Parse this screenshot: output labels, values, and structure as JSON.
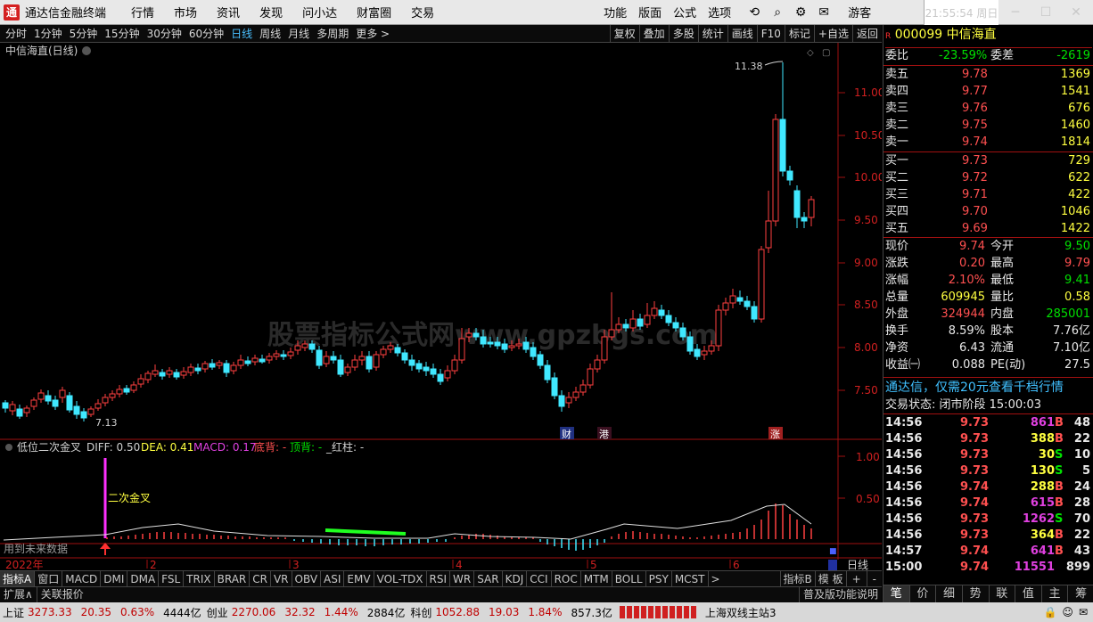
{
  "app": {
    "title": "通达信金融终端",
    "logo": "通",
    "menus": [
      "行情",
      "市场",
      "资讯",
      "发现",
      "问小达",
      "财富圈",
      "交易"
    ],
    "right_menus": [
      "功能",
      "版面",
      "公式",
      "选项"
    ],
    "user": "游客",
    "clock": "21:55:54 周日"
  },
  "periods": [
    "分时",
    "1分钟",
    "5分钟",
    "15分钟",
    "30分钟",
    "60分钟",
    "日线",
    "周线",
    "月线",
    "多周期",
    "更多 >"
  ],
  "period_active": 6,
  "tools": [
    "复权",
    "叠加",
    "多股",
    "统计",
    "画线",
    "F10",
    "标记",
    "+自选",
    "返回"
  ],
  "chart": {
    "title": "中信海直(日线)",
    "high_label": "11.38",
    "low_label": "7.13",
    "price_ticks": [
      "11.00",
      "10.50",
      "10.00",
      "9.50",
      "9.00",
      "8.50",
      "8.00",
      "7.50"
    ],
    "markers": [
      "财",
      "港",
      "涨"
    ],
    "watermark": "股票指标公式网www.gpzbgs.com"
  },
  "indicator": {
    "name": "低位二次金叉",
    "diff": "DIFF: 0.50",
    "dea": "DEA: 0.41",
    "macd": "MACD: 0.17",
    "bottom": "底背: -",
    "top": "顶背: -",
    "red": "_红柱: -",
    "label": "二次金叉",
    "future": "用到未来数据",
    "ticks": [
      "1.00",
      "0.50"
    ]
  },
  "timeaxis": [
    "2022年",
    "2",
    "3",
    "4",
    "5",
    "6"
  ],
  "tabs": [
    "指标A",
    "窗口",
    "MACD",
    "DMI",
    "DMA",
    "FSL",
    "TRIX",
    "BRAR",
    "CR",
    "VR",
    "OBV",
    "ASI",
    "EMV",
    "VOL-TDX",
    "RSI",
    "WR",
    "SAR",
    "KDJ",
    "CCI",
    "ROC",
    "MTM",
    "BOLL",
    "PSY",
    "MCST",
    ">"
  ],
  "tabs_right": [
    "指标B",
    "模 板",
    "+",
    "-"
  ],
  "daily_label": "日线",
  "expand": [
    "扩展∧",
    "关联报价"
  ],
  "func_label": "普及版功能说明",
  "right_tabs": [
    "笔",
    "价",
    "细",
    "势",
    "联",
    "值",
    "主",
    "筹"
  ],
  "stock": {
    "code": "000099",
    "name": "中信海直"
  },
  "book": {
    "weibi_label": "委比",
    "weibi": "-23.59%",
    "weicha_label": "委差",
    "weicha": "-2619",
    "asks": [
      {
        "label": "卖五",
        "price": "9.78",
        "vol": "1369"
      },
      {
        "label": "卖四",
        "price": "9.77",
        "vol": "1541"
      },
      {
        "label": "卖三",
        "price": "9.76",
        "vol": "676"
      },
      {
        "label": "卖二",
        "price": "9.75",
        "vol": "1460"
      },
      {
        "label": "卖一",
        "price": "9.74",
        "vol": "1814"
      }
    ],
    "bids": [
      {
        "label": "买一",
        "price": "9.73",
        "vol": "729"
      },
      {
        "label": "买二",
        "price": "9.72",
        "vol": "622"
      },
      {
        "label": "买三",
        "price": "9.71",
        "vol": "422"
      },
      {
        "label": "买四",
        "price": "9.70",
        "vol": "1046"
      },
      {
        "label": "买五",
        "price": "9.69",
        "vol": "1422"
      }
    ]
  },
  "quote": [
    {
      "l1": "现价",
      "v1": "9.74",
      "l2": "今开",
      "v2": "9.50",
      "c1": "red",
      "c2": "grn"
    },
    {
      "l1": "涨跌",
      "v1": "0.20",
      "l2": "最高",
      "v2": "9.79",
      "c1": "red",
      "c2": "red"
    },
    {
      "l1": "涨幅",
      "v1": "2.10%",
      "l2": "最低",
      "v2": "9.41",
      "c1": "red",
      "c2": "grn"
    },
    {
      "l1": "总量",
      "v1": "609945",
      "l2": "量比",
      "v2": "0.58",
      "c1": "yel",
      "c2": "yel"
    },
    {
      "l1": "外盘",
      "v1": "324944",
      "l2": "内盘",
      "v2": "285001",
      "c1": "red",
      "c2": "grn"
    },
    {
      "l1": "换手",
      "v1": "8.59%",
      "l2": "股本",
      "v2": "7.76亿",
      "c1": "wht",
      "c2": "wht"
    },
    {
      "l1": "净资",
      "v1": "6.43",
      "l2": "流通",
      "v2": "7.10亿",
      "c1": "wht",
      "c2": "wht"
    },
    {
      "l1": "收益㈠",
      "v1": "0.088",
      "l2": "PE(动)",
      "v2": "27.5",
      "c1": "wht",
      "c2": "wht"
    }
  ],
  "notice": "通达信，仅需20元查看千档行情",
  "trade_status": "交易状态: 闭市阶段 15:00:03",
  "ticks": [
    {
      "t": "14:56",
      "p": "9.73",
      "v": "861",
      "s": "B",
      "n": "48",
      "pc": "red",
      "vc": "mag",
      "sc": "red"
    },
    {
      "t": "14:56",
      "p": "9.73",
      "v": "388",
      "s": "B",
      "n": "22",
      "pc": "red",
      "vc": "yel",
      "sc": "red"
    },
    {
      "t": "14:56",
      "p": "9.73",
      "v": "30",
      "s": "S",
      "n": "10",
      "pc": "red",
      "vc": "yel",
      "sc": "grn"
    },
    {
      "t": "14:56",
      "p": "9.73",
      "v": "130",
      "s": "S",
      "n": "5",
      "pc": "red",
      "vc": "yel",
      "sc": "grn"
    },
    {
      "t": "14:56",
      "p": "9.74",
      "v": "288",
      "s": "B",
      "n": "24",
      "pc": "red",
      "vc": "yel",
      "sc": "red"
    },
    {
      "t": "14:56",
      "p": "9.74",
      "v": "615",
      "s": "B",
      "n": "28",
      "pc": "red",
      "vc": "mag",
      "sc": "red"
    },
    {
      "t": "14:56",
      "p": "9.73",
      "v": "1262",
      "s": "S",
      "n": "70",
      "pc": "red",
      "vc": "mag",
      "sc": "grn"
    },
    {
      "t": "14:56",
      "p": "9.73",
      "v": "364",
      "s": "B",
      "n": "22",
      "pc": "red",
      "vc": "yel",
      "sc": "red"
    },
    {
      "t": "14:57",
      "p": "9.74",
      "v": "641",
      "s": "B",
      "n": "43",
      "pc": "red",
      "vc": "mag",
      "sc": "red"
    },
    {
      "t": "15:00",
      "p": "9.74",
      "v": "11551",
      "s": "",
      "n": "899",
      "pc": "red",
      "vc": "mag",
      "sc": "wht"
    }
  ],
  "statusbar": {
    "sh_label": "上证",
    "sh": "3273.33",
    "sh_chg": "20.35",
    "sh_pct": "0.63%",
    "sh_amt": "4444亿",
    "cy_label": "创业",
    "cy": "2270.06",
    "cy_chg": "32.32",
    "cy_pct": "1.44%",
    "cy_amt": "2884亿",
    "kc_label": "科创",
    "kc": "1052.88",
    "kc_chg": "19.03",
    "kc_pct": "1.84%",
    "kc_amt": "857.3亿",
    "server": "上海双线主站3"
  }
}
